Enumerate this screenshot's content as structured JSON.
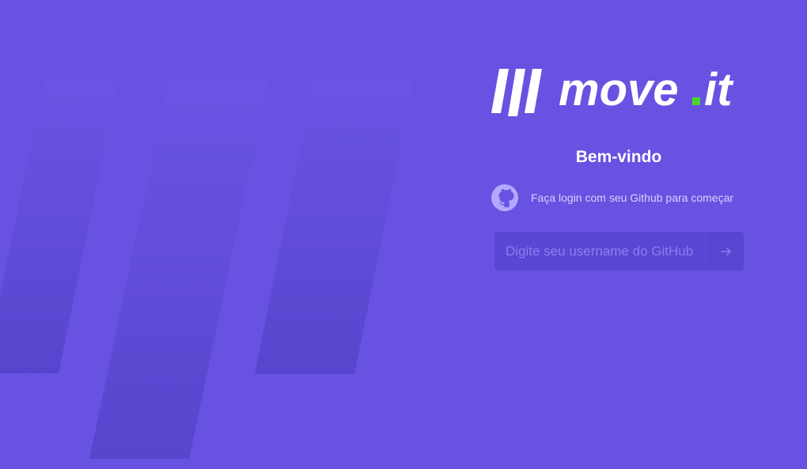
{
  "app": {
    "name": "move.it"
  },
  "login": {
    "welcome_title": "Bem-vindo",
    "github_prompt": "Faça login com seu Github para começar",
    "username_placeholder": "Digite seu username do GitHub",
    "submit_icon": "arrow-right-icon"
  },
  "icons": {
    "github": "github-icon",
    "logo": "move-it-logo"
  },
  "colors": {
    "background": "#6852e1",
    "accent": "#4cd62b",
    "input_background": "#5a47d3"
  }
}
